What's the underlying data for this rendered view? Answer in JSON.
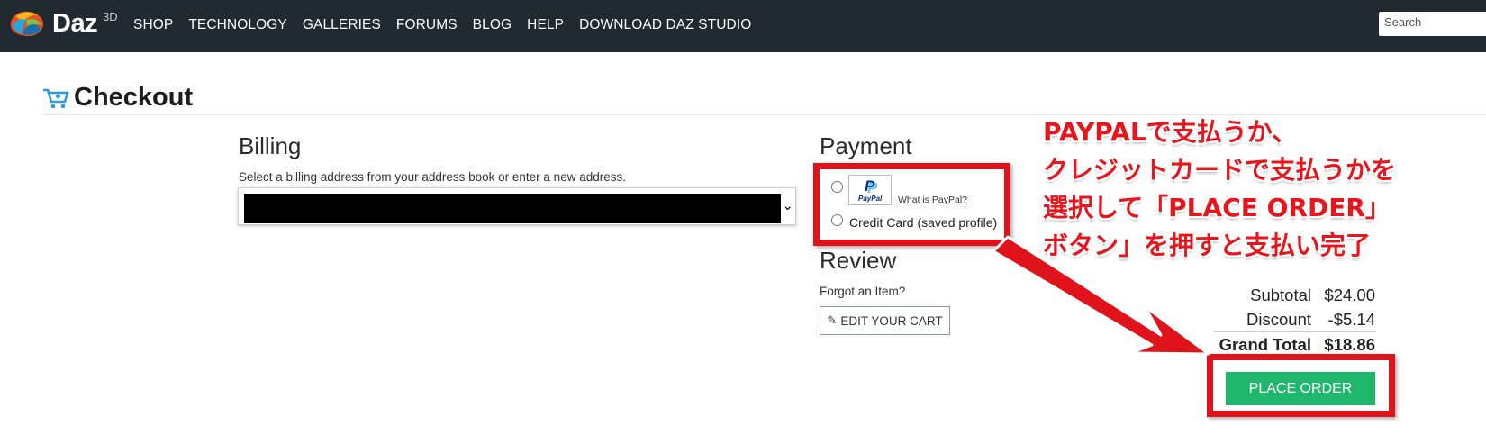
{
  "brand": {
    "name": "Daz",
    "superscript": "3D",
    "logo_icon": "daz-dragon-logo"
  },
  "nav": {
    "items": [
      "SHOP",
      "TECHNOLOGY",
      "GALLERIES",
      "FORUMS",
      "BLOG",
      "HELP",
      "DOWNLOAD DAZ STUDIO"
    ],
    "search_placeholder": "Search"
  },
  "page": {
    "title": "Checkout",
    "title_icon": "shopping-cart-icon"
  },
  "billing": {
    "title": "Billing",
    "help_text": "Select a billing address from your address book or enter a new address.",
    "selected_address": ""
  },
  "payment": {
    "title": "Payment",
    "paypal_logo_text": "PayPal",
    "what_is_paypal": "What is PayPal?",
    "credit_card_label": "Credit Card (saved profile)"
  },
  "review": {
    "title": "Review",
    "forgot_text": "Forgot an Item?",
    "edit_cart_label": "EDIT YOUR CART"
  },
  "totals": {
    "subtotal_label": "Subtotal",
    "subtotal_value": "$24.00",
    "discount_label": "Discount",
    "discount_value": "-$5.14",
    "grand_total_label": "Grand Total",
    "grand_total_value": "$18.86"
  },
  "place_order_label": "PLACE ORDER",
  "annotation": {
    "lines": [
      "PAYPALで支払うか、",
      "クレジットカードで支払うかを",
      "選択して「PLACE ORDER」",
      "ボタン」を押すと支払い完了"
    ],
    "color": "#e0131a"
  },
  "colors": {
    "topbar": "#212931",
    "place_order": "#1fb76b",
    "annotation_red": "#e0131a"
  }
}
